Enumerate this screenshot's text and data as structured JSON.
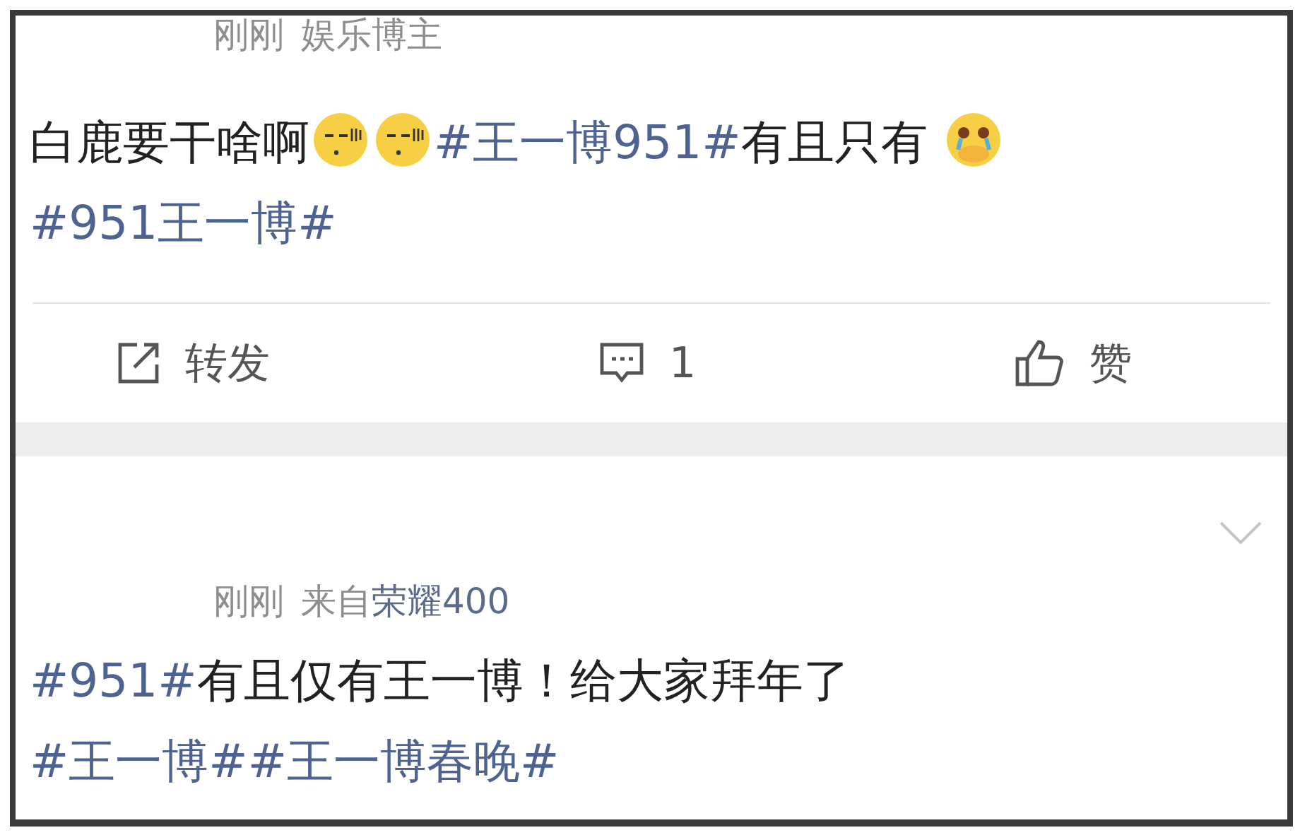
{
  "posts": [
    {
      "meta": {
        "time": "刚刚",
        "source": "娱乐博主",
        "linked": false
      },
      "text": [
        {
          "kind": "text",
          "value": "白鹿要干啥啊"
        },
        {
          "kind": "meh"
        },
        {
          "kind": "meh"
        },
        {
          "kind": "topic",
          "value": "#王一博951#"
        },
        {
          "kind": "text",
          "value": "有且只有 "
        },
        {
          "kind": "crying"
        },
        {
          "kind": "topic",
          "value": "#951王一博#"
        }
      ],
      "actions": [
        {
          "kind": "repost",
          "label": "转发"
        },
        {
          "kind": "comment",
          "label": "1"
        },
        {
          "kind": "like",
          "label": "赞"
        }
      ]
    },
    {
      "collapsible": true,
      "meta": {
        "time": "刚刚",
        "source_prefix": "来自",
        "source": "荣耀400",
        "linked": true
      },
      "text": [
        {
          "kind": "topic",
          "value": "#951#"
        },
        {
          "kind": "text",
          "value": "有且仅有王一博！给大家拜年了"
        },
        {
          "kind": "topic",
          "value": "#王一博#"
        },
        {
          "kind": "topic",
          "value": "#王一博春晚#"
        }
      ]
    }
  ]
}
